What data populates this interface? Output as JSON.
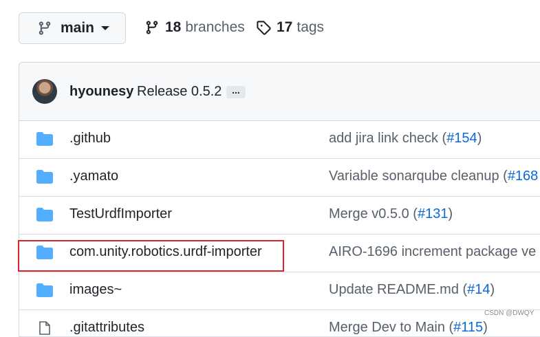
{
  "branch_selector": {
    "label": "main"
  },
  "stats": {
    "branches_count": "18",
    "branches_label": "branches",
    "tags_count": "17",
    "tags_label": "tags"
  },
  "latest_commit": {
    "author": "hyounesy",
    "message": "Release 0.5.2",
    "ellipsis": "..."
  },
  "files": [
    {
      "name": ".github",
      "message": "add jira link check (",
      "pr": "#154",
      "suffix": ")",
      "icon": "folder-icon"
    },
    {
      "name": ".yamato",
      "message": "Variable sonarqube cleanup (",
      "pr": "#168",
      "suffix": "",
      "icon": "folder-icon"
    },
    {
      "name": "TestUrdfImporter",
      "message": "Merge v0.5.0 (",
      "pr": "#131",
      "suffix": ")",
      "icon": "folder-icon"
    },
    {
      "name": "com.unity.robotics.urdf-importer",
      "message": "AIRO-1696 increment package ve",
      "pr": "",
      "suffix": "",
      "icon": "folder-icon"
    },
    {
      "name": "images~",
      "message": "Update README.md (",
      "pr": "#14",
      "suffix": ")",
      "icon": "folder-icon"
    },
    {
      "name": ".gitattributes",
      "message": "Merge Dev to Main (",
      "pr": "#115",
      "suffix": ")",
      "icon": "file-icon"
    }
  ],
  "watermark": "CSDN @DWQY",
  "colors": {
    "folder": "#54aeff",
    "link": "#0969da",
    "highlight": "#d9252b"
  }
}
